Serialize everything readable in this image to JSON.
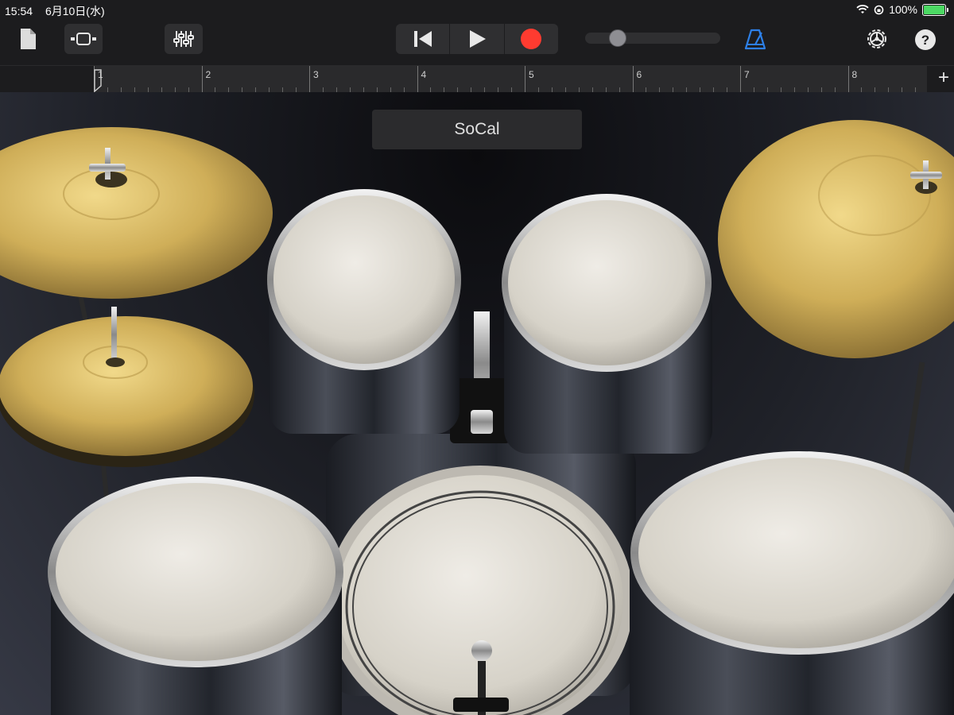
{
  "status_bar": {
    "time": "15:54",
    "date": "6月10日(水)",
    "battery": "100%"
  },
  "toolbar": {
    "icons": [
      "document-icon",
      "view-toggle-icon",
      "mixer-icon",
      "go-to-start-icon",
      "play-icon",
      "record-icon",
      "metronome-icon",
      "settings-icon",
      "help-icon"
    ],
    "master_volume_level": 0.2
  },
  "ruler": {
    "bars": [
      "1",
      "2",
      "3",
      "4",
      "5",
      "6",
      "7",
      "8"
    ],
    "add_label": "+"
  },
  "kit": {
    "name": "SoCal"
  },
  "colors": {
    "record": "#ff3b30",
    "metronome": "#2d7fe6",
    "cymbal": "#d4b25e",
    "drumhead": "#ddd9d0",
    "battery_fill": "#4cd964"
  }
}
